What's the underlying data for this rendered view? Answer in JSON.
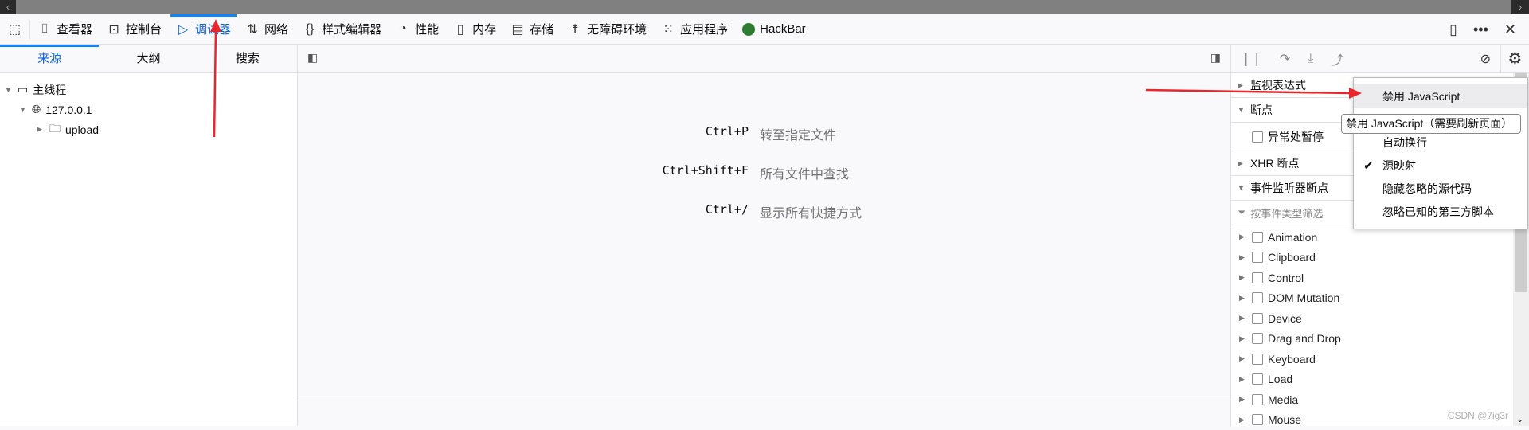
{
  "toolbar": {
    "tabs": [
      {
        "label": "查看器",
        "icon": "inspector-icon"
      },
      {
        "label": "控制台",
        "icon": "console-icon"
      },
      {
        "label": "调试器",
        "icon": "debugger-icon",
        "selected": true
      },
      {
        "label": "网络",
        "icon": "network-icon"
      },
      {
        "label": "样式编辑器",
        "icon": "style-editor-icon"
      },
      {
        "label": "性能",
        "icon": "performance-icon"
      },
      {
        "label": "内存",
        "icon": "memory-icon"
      },
      {
        "label": "存储",
        "icon": "storage-icon"
      },
      {
        "label": "无障碍环境",
        "icon": "accessibility-icon"
      },
      {
        "label": "应用程序",
        "icon": "application-icon"
      },
      {
        "label": "HackBar",
        "icon": "hackbar-icon"
      }
    ]
  },
  "left": {
    "tabs": [
      "来源",
      "大纲",
      "搜索"
    ],
    "tree": {
      "thread": "主线程",
      "host": "127.0.0.1",
      "folder": "upload"
    }
  },
  "shortcuts": [
    {
      "key": "Ctrl+P",
      "text": "转至指定文件"
    },
    {
      "key": "Ctrl+Shift+F",
      "text": "所有文件中查找"
    },
    {
      "key": "Ctrl+/",
      "text": "显示所有快捷方式"
    }
  ],
  "right": {
    "watch": "监视表达式",
    "breakpoints": "断点",
    "pause_exceptions": "异常处暂停",
    "xhr": "XHR 断点",
    "event_listeners": "事件监听器断点",
    "filter_placeholder": "按事件类型筛选",
    "events": [
      "Animation",
      "Clipboard",
      "Control",
      "DOM Mutation",
      "Device",
      "Drag and Drop",
      "Keyboard",
      "Load",
      "Media",
      "Mouse"
    ]
  },
  "menu": {
    "items": [
      {
        "label": "禁用 JavaScript",
        "checked": false
      },
      {
        "label": "",
        "checked": false
      },
      {
        "label": "自动换行",
        "checked": false
      },
      {
        "label": "源映射",
        "checked": true
      },
      {
        "label": "隐藏忽略的源代码",
        "checked": false
      },
      {
        "label": "忽略已知的第三方脚本",
        "checked": false
      }
    ]
  },
  "tooltip": "禁用 JavaScript（需要刷新页面）",
  "watermark": "CSDN @7ig3r",
  "colors": {
    "accent": "#0a84ff",
    "arrow": "#e8262b"
  }
}
